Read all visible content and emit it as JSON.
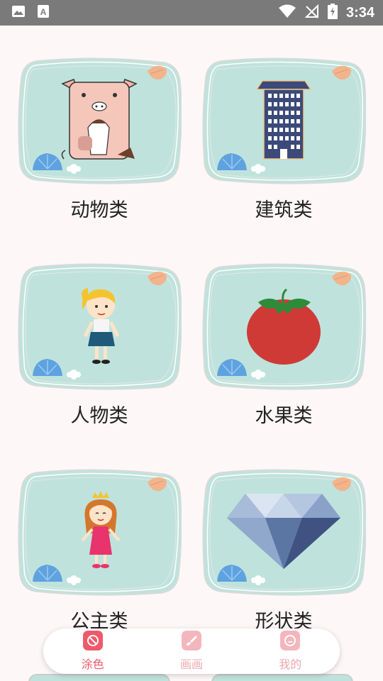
{
  "status_bar": {
    "time": "3:34",
    "icons": [
      "image-icon",
      "a-text-icon",
      "wifi-icon",
      "no-signal-icon",
      "battery-charging-icon"
    ]
  },
  "categories": [
    {
      "label": "动物类",
      "art": "pig-icon"
    },
    {
      "label": "建筑类",
      "art": "building-icon"
    },
    {
      "label": "人物类",
      "art": "girl-icon"
    },
    {
      "label": "水果类",
      "art": "tomato-icon"
    },
    {
      "label": "公主类",
      "art": "princess-icon"
    },
    {
      "label": "形状类",
      "art": "diamond-icon"
    }
  ],
  "nav": {
    "items": [
      {
        "label": "涂色",
        "icon": "coloring-icon",
        "active": true
      },
      {
        "label": "画画",
        "icon": "brush-icon",
        "active": false
      },
      {
        "label": "我的",
        "icon": "profile-icon",
        "active": false
      }
    ],
    "colors": {
      "active": "#ef5a6a",
      "inactive": "#f0a8b0"
    }
  },
  "colors": {
    "card_bg": "#bfe3dc",
    "page_bg": "#fdf7f7",
    "status_bg": "#7a7a7a"
  }
}
